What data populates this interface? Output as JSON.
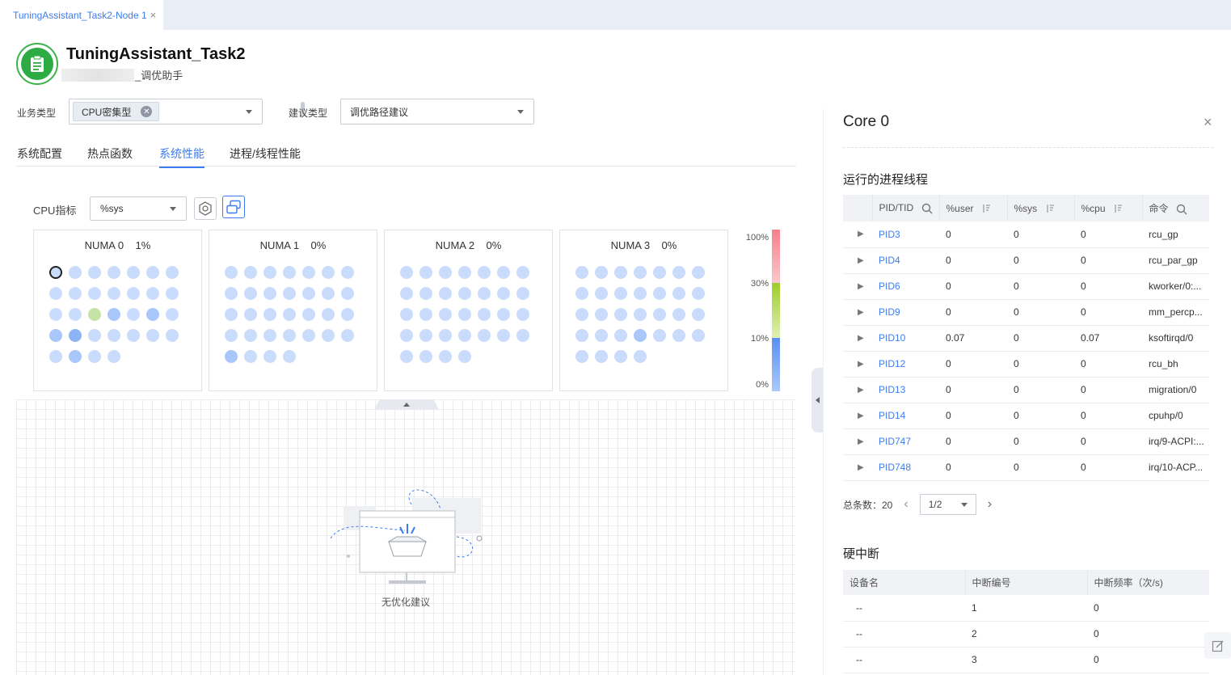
{
  "tab": {
    "label": "TuningAssistant_Task2-Node 1",
    "close": "×"
  },
  "header": {
    "title": "TuningAssistant_Task2",
    "subtitle": "_调优助手"
  },
  "filters": {
    "business_type_label": "业务类型",
    "business_type_chip": "CPU密集型",
    "suggestion_type_label": "建议类型",
    "suggestion_type_value": "调优路径建议"
  },
  "subtabs": [
    "系统配置",
    "热点函数",
    "系统性能",
    "进程/线程性能"
  ],
  "active_subtab": 2,
  "cpu_metric": {
    "label": "CPU指标",
    "value": "%sys"
  },
  "numa": [
    {
      "name": "NUMA 0",
      "value": "1%"
    },
    {
      "name": "NUMA 1",
      "value": "0%"
    },
    {
      "name": "NUMA 2",
      "value": "0%"
    },
    {
      "name": "NUMA 3",
      "value": "0%"
    }
  ],
  "legend": {
    "labels": [
      "100%",
      "30%",
      "10%",
      "0%"
    ],
    "colors": [
      "#f59aa2",
      "#9fd23a",
      "#6f9ef5"
    ]
  },
  "empty_state": "无优化建议",
  "core_panel": {
    "title": "Core 0",
    "close": "×",
    "process_section": "运行的进程线程",
    "columns": [
      "PID/TID",
      "%user",
      "%sys",
      "%cpu",
      "命令"
    ],
    "rows": [
      {
        "pid": "PID3",
        "user": "0",
        "sys": "0",
        "cpu": "0",
        "cmd": "rcu_gp"
      },
      {
        "pid": "PID4",
        "user": "0",
        "sys": "0",
        "cpu": "0",
        "cmd": "rcu_par_gp"
      },
      {
        "pid": "PID6",
        "user": "0",
        "sys": "0",
        "cpu": "0",
        "cmd": "kworker/0:..."
      },
      {
        "pid": "PID9",
        "user": "0",
        "sys": "0",
        "cpu": "0",
        "cmd": "mm_percp..."
      },
      {
        "pid": "PID10",
        "user": "0.07",
        "sys": "0",
        "cpu": "0.07",
        "cmd": "ksoftirqd/0"
      },
      {
        "pid": "PID12",
        "user": "0",
        "sys": "0",
        "cpu": "0",
        "cmd": "rcu_bh"
      },
      {
        "pid": "PID13",
        "user": "0",
        "sys": "0",
        "cpu": "0",
        "cmd": "migration/0"
      },
      {
        "pid": "PID14",
        "user": "0",
        "sys": "0",
        "cpu": "0",
        "cmd": "cpuhp/0"
      },
      {
        "pid": "PID747",
        "user": "0",
        "sys": "0",
        "cpu": "0",
        "cmd": "irq/9-ACPI:..."
      },
      {
        "pid": "PID748",
        "user": "0",
        "sys": "0",
        "cpu": "0",
        "cmd": "irq/10-ACP..."
      }
    ],
    "pager": {
      "total_label": "总条数：20",
      "page": "1/2",
      "prev": "‹",
      "next": "›"
    },
    "irq_section": "硬中断",
    "irq_columns": [
      "设备名",
      "中断编号",
      "中断频率（次/s)"
    ],
    "irq_rows": [
      {
        "device": "--",
        "num": "1",
        "freq": "0"
      },
      {
        "device": "--",
        "num": "2",
        "freq": "0"
      },
      {
        "device": "--",
        "num": "3",
        "freq": "0"
      }
    ]
  }
}
